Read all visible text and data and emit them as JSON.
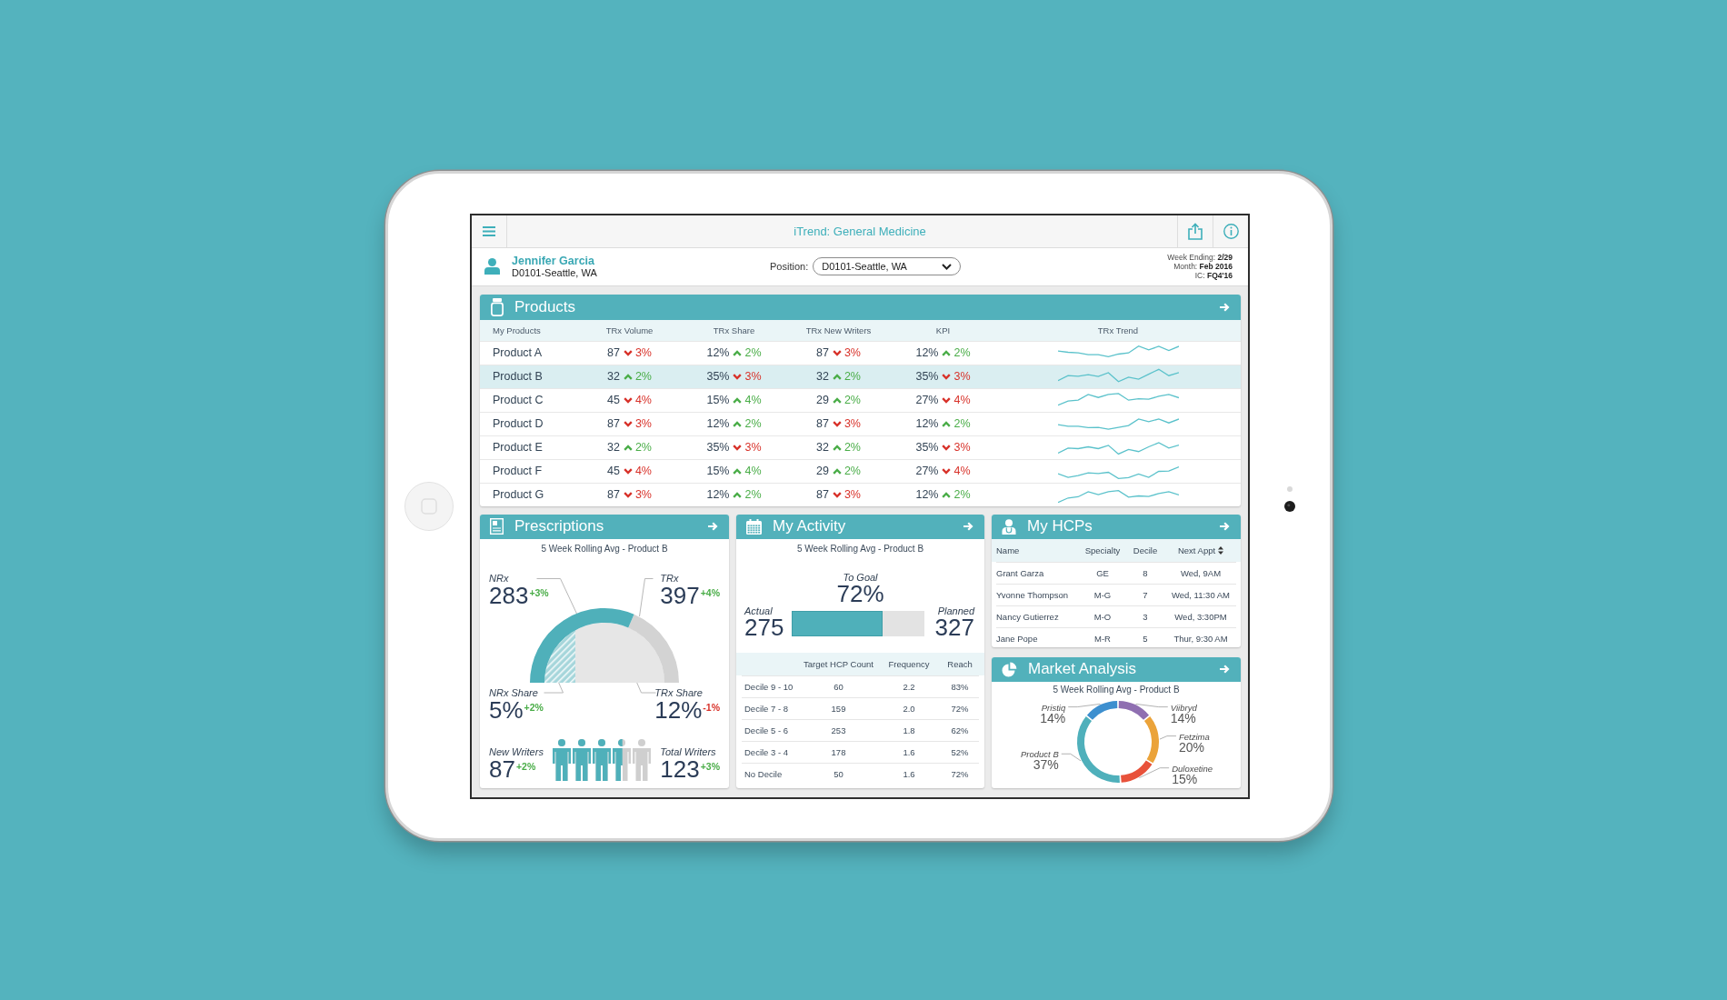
{
  "window": {
    "title": "iTrend: General Medicine"
  },
  "user": {
    "name": "Jennifer Garcia",
    "territory": "D0101-Seattle, WA"
  },
  "position": {
    "label": "Position:",
    "value": "D0101-Seattle, WA"
  },
  "period": [
    "Week Ending: **2/29**",
    "Month: **Feb 2016**",
    "IC: **FQ4'16**"
  ],
  "products": {
    "title": "Products",
    "columns": [
      "My Products",
      "TRx Volume",
      "TRx Share",
      "TRx New Writers",
      "KPI",
      "TRx Trend"
    ],
    "rows": [
      {
        "name": "Product A",
        "selected": false,
        "metrics": [
          {
            "value": "87",
            "change": "3%",
            "rising": false
          },
          {
            "value": "12%",
            "change": "2%",
            "rising": true
          },
          {
            "value": "87",
            "change": "3%",
            "rising": false
          },
          {
            "value": "12%",
            "change": "2%",
            "rising": true
          }
        ]
      },
      {
        "name": "Product B",
        "selected": true,
        "metrics": [
          {
            "value": "32",
            "change": "2%",
            "rising": true
          },
          {
            "value": "35%",
            "change": "3%",
            "rising": false
          },
          {
            "value": "32",
            "change": "2%",
            "rising": true
          },
          {
            "value": "35%",
            "change": "3%",
            "rising": false
          }
        ]
      },
      {
        "name": "Product C",
        "selected": false,
        "metrics": [
          {
            "value": "45",
            "change": "4%",
            "rising": false
          },
          {
            "value": "15%",
            "change": "4%",
            "rising": true
          },
          {
            "value": "29",
            "change": "2%",
            "rising": true
          },
          {
            "value": "27%",
            "change": "4%",
            "rising": false
          }
        ]
      },
      {
        "name": "Product D",
        "selected": false,
        "metrics": [
          {
            "value": "87",
            "change": "3%",
            "rising": false
          },
          {
            "value": "12%",
            "change": "2%",
            "rising": true
          },
          {
            "value": "87",
            "change": "3%",
            "rising": false
          },
          {
            "value": "12%",
            "change": "2%",
            "rising": true
          }
        ]
      },
      {
        "name": "Product E",
        "selected": false,
        "metrics": [
          {
            "value": "32",
            "change": "2%",
            "rising": true
          },
          {
            "value": "35%",
            "change": "3%",
            "rising": false
          },
          {
            "value": "32",
            "change": "2%",
            "rising": true
          },
          {
            "value": "35%",
            "change": "3%",
            "rising": false
          }
        ]
      },
      {
        "name": "Product F",
        "selected": false,
        "metrics": [
          {
            "value": "45",
            "change": "4%",
            "rising": false
          },
          {
            "value": "15%",
            "change": "4%",
            "rising": true
          },
          {
            "value": "29",
            "change": "2%",
            "rising": true
          },
          {
            "value": "27%",
            "change": "4%",
            "rising": false
          }
        ]
      },
      {
        "name": "Product G",
        "selected": false,
        "metrics": [
          {
            "value": "87",
            "change": "3%",
            "rising": false
          },
          {
            "value": "12%",
            "change": "2%",
            "rising": true
          },
          {
            "value": "87",
            "change": "3%",
            "rising": false
          },
          {
            "value": "12%",
            "change": "2%",
            "rising": true
          }
        ]
      }
    ]
  },
  "prescriptions": {
    "title": "Prescriptions",
    "subtitle": "5 Week Rolling Avg - Product B",
    "metrics": [
      {
        "label": "NRx",
        "value": "283",
        "change": "+3%",
        "rising": true
      },
      {
        "label": "TRx",
        "value": "397",
        "change": "+4%",
        "rising": true
      },
      {
        "label": "NRx Share",
        "value": "5%",
        "change": "+2%",
        "rising": true
      },
      {
        "label": "TRx Share",
        "value": "12%",
        "change": "-1%",
        "rising": false
      },
      {
        "label": "New Writers",
        "value": "87",
        "change": "+2%",
        "rising": true
      },
      {
        "label": "Total Writers",
        "value": "123",
        "change": "+3%",
        "rising": true
      }
    ],
    "writers_meter": {
      "level": 0.71
    }
  },
  "activity": {
    "title": "My Activity",
    "subtitle": "5 Week Rolling Avg - Product B",
    "goal": {
      "label": "To Goal",
      "value": "72%"
    },
    "actual": {
      "label": "Actual",
      "value": "275"
    },
    "planned": {
      "label": "Planned",
      "value": "327"
    },
    "progress": {
      "level": 0.69
    },
    "table": {
      "columns": [
        "Target HCP Count",
        "Frequency",
        "Reach"
      ],
      "rows": [
        {
          "label": "Decile 9 - 10",
          "cells": [
            "60",
            "2.2",
            "83%"
          ]
        },
        {
          "label": "Decile 7 - 8",
          "cells": [
            "159",
            "2.0",
            "72%"
          ]
        },
        {
          "label": "Decile 5 - 6",
          "cells": [
            "253",
            "1.8",
            "62%"
          ]
        },
        {
          "label": "Decile 3 - 4",
          "cells": [
            "178",
            "1.6",
            "52%"
          ]
        },
        {
          "label": "No Decile",
          "cells": [
            "50",
            "1.6",
            "72%"
          ]
        }
      ]
    }
  },
  "hcps": {
    "title": "My HCPs",
    "columns": [
      {
        "label": "Name",
        "sortable": false
      },
      {
        "label": "Specialty",
        "sortable": false
      },
      {
        "label": "Decile",
        "sortable": false
      },
      {
        "label": "Next Appt",
        "sortable": true
      }
    ],
    "rows": [
      {
        "cells": [
          "Grant Garza",
          "GE",
          "8",
          "Wed, 9AM"
        ]
      },
      {
        "cells": [
          "Yvonne Thompson",
          "M-G",
          "7",
          "Wed, 11:30 AM"
        ]
      },
      {
        "cells": [
          "Nancy Gutierrez",
          "M-O",
          "3",
          "Wed, 3:30PM"
        ]
      },
      {
        "cells": [
          "Jane Pope",
          "M-R",
          "5",
          "Thur, 9:30 AM"
        ]
      }
    ]
  },
  "market": {
    "title": "Market Analysis",
    "chart_data": {
      "type": "donut",
      "title": "5 Week Rolling Avg - Product B",
      "categories": [
        "Viibryd",
        "Fetzima",
        "Duloxetine",
        "Product B",
        "Pristiq"
      ],
      "values": [
        14,
        20,
        15,
        37,
        14
      ],
      "value_labels": [
        "14%",
        "20%",
        "15%",
        "37%",
        "14%"
      ],
      "colors": [
        "#8f6fb1",
        "#eba33a",
        "#e8523b",
        "#4fb0bb",
        "#3d8fcf"
      ]
    }
  }
}
